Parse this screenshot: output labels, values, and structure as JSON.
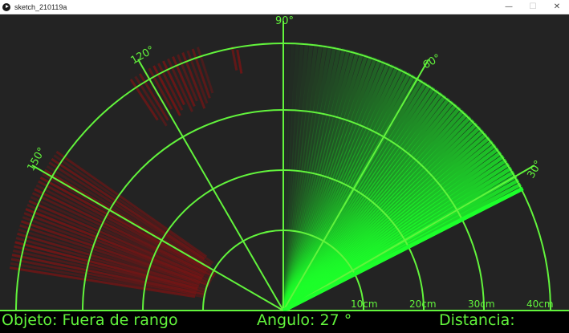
{
  "window": {
    "title": "sketch_210119a",
    "minimize_glyph": "—",
    "maximize_glyph": "☐",
    "close_glyph": "✕"
  },
  "radar": {
    "angle_labels": [
      "30°",
      "60°",
      "90°",
      "120°",
      "150°"
    ],
    "distance_labels": [
      "10cm",
      "20cm",
      "30cm",
      "40cm"
    ],
    "sweep_angle_deg": 27,
    "colors": {
      "background": "#232323",
      "grid": "#62f43c",
      "sweep": "#1cff2a",
      "object": "#7a1414",
      "status_bar": "#000000"
    }
  },
  "status": {
    "object_text": "Objeto: Fuera de rango",
    "angle_text": "Angulo: 27 °",
    "distance_text": "Distancia:"
  }
}
